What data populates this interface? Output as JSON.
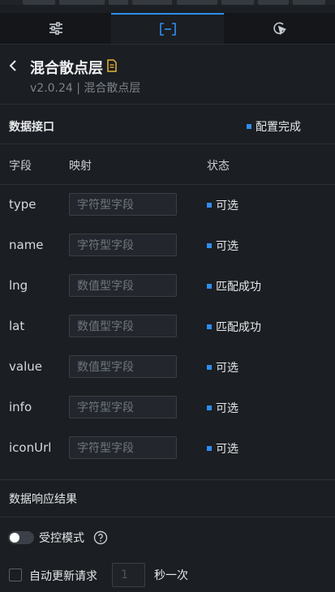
{
  "tabs": [
    {
      "icon": "sliders-icon",
      "active": false
    },
    {
      "icon": "data-bracket-icon",
      "active": true
    },
    {
      "icon": "interaction-icon",
      "active": false
    }
  ],
  "header": {
    "title": "混合散点层",
    "subtitle": "v2.0.24 | 混合散点层"
  },
  "data_interface": {
    "title": "数据接口",
    "status": "配置完成"
  },
  "columns": {
    "field": "字段",
    "mapping": "映射",
    "status": "状态"
  },
  "rows": [
    {
      "field": "type",
      "placeholder": "字符型字段",
      "status": "可选"
    },
    {
      "field": "name",
      "placeholder": "字符型字段",
      "status": "可选"
    },
    {
      "field": "lng",
      "placeholder": "数值型字段",
      "status": "匹配成功"
    },
    {
      "field": "lat",
      "placeholder": "数值型字段",
      "status": "匹配成功"
    },
    {
      "field": "value",
      "placeholder": "数值型字段",
      "status": "可选"
    },
    {
      "field": "info",
      "placeholder": "字符型字段",
      "status": "可选"
    },
    {
      "field": "iconUrl",
      "placeholder": "字符型字段",
      "status": "可选"
    }
  ],
  "response": {
    "title": "数据响应结果"
  },
  "controlled_mode": {
    "label": "受控模式",
    "enabled": false
  },
  "auto_update": {
    "label": "自动更新请求",
    "checked": false,
    "interval_placeholder": "1",
    "unit": "秒一次"
  },
  "colors": {
    "accent": "#2e8ef0",
    "background": "#1b1e22"
  }
}
